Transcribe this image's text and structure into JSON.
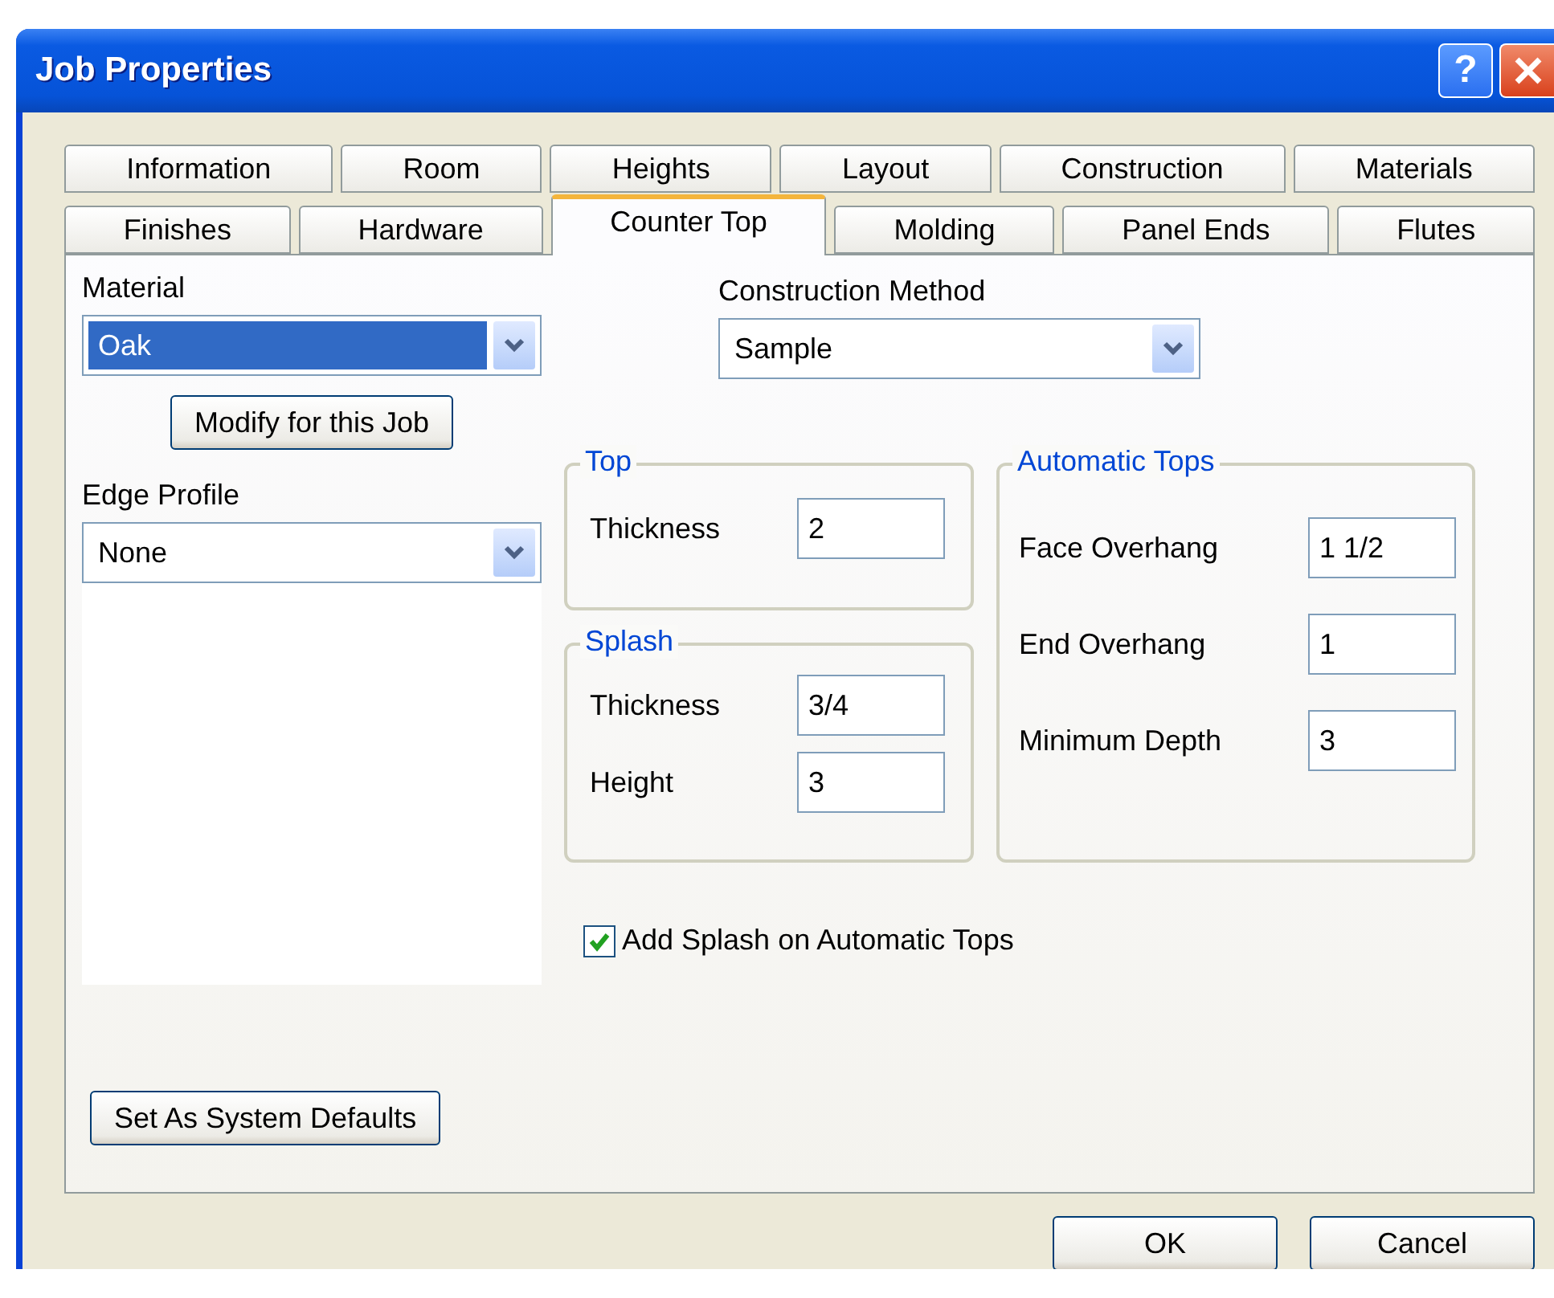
{
  "window": {
    "title": "Job Properties"
  },
  "title_buttons": [
    {
      "kind": "help",
      "label": "?"
    },
    {
      "kind": "close"
    }
  ],
  "tab_rows": [
    {
      "tabs": [
        {
          "label": "Information",
          "selected": false
        },
        {
          "label": "Room",
          "selected": false
        },
        {
          "label": "Heights",
          "selected": false
        },
        {
          "label": "Layout",
          "selected": false
        },
        {
          "label": "Construction",
          "selected": false
        },
        {
          "label": "Materials",
          "selected": false
        }
      ]
    },
    {
      "tabs": [
        {
          "label": "Finishes",
          "selected": false
        },
        {
          "label": "Hardware",
          "selected": false
        },
        {
          "label": "Counter Top",
          "selected": true
        },
        {
          "label": "Molding",
          "selected": false
        },
        {
          "label": "Panel Ends",
          "selected": false
        },
        {
          "label": "Flutes",
          "selected": false
        }
      ]
    }
  ],
  "material": {
    "label": "Material",
    "value": "Oak",
    "highlighted": true
  },
  "modify_button": "Modify for this Job",
  "construction_method": {
    "label": "Construction Method",
    "value": "Sample",
    "highlighted": false
  },
  "edge_profile": {
    "label": "Edge Profile",
    "value": "None",
    "highlighted": false
  },
  "top": {
    "title": "Top",
    "fields": [
      {
        "label": "Thickness",
        "value": "2"
      }
    ]
  },
  "splash": {
    "title": "Splash",
    "fields": [
      {
        "label": "Thickness",
        "value": "3/4"
      },
      {
        "label": "Height",
        "value": "3"
      }
    ]
  },
  "automatic_tops": {
    "title": "Automatic Tops",
    "fields": [
      {
        "label": "Face Overhang",
        "value": "1 1/2"
      },
      {
        "label": "End Overhang",
        "value": "1"
      },
      {
        "label": "Minimum Depth",
        "value": "3"
      }
    ]
  },
  "add_splash": {
    "label": "Add Splash on Automatic Tops",
    "checked": true
  },
  "defaults_button": "Set As System Defaults",
  "buttons": [
    {
      "label": "OK"
    },
    {
      "label": "Cancel"
    }
  ]
}
